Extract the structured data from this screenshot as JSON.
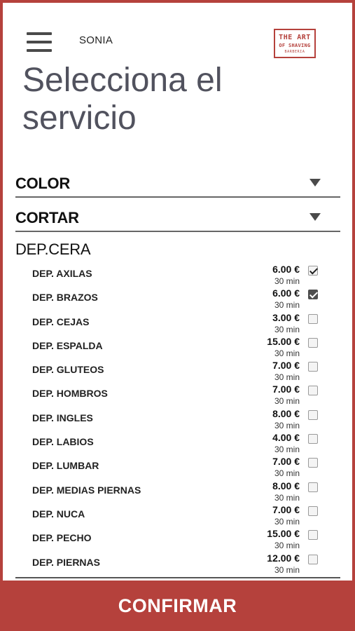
{
  "header": {
    "user_name": "SONIA",
    "logo": {
      "line1": "THE ART",
      "line2": "OF SHAVING",
      "line3": "BARBERIA"
    }
  },
  "page": {
    "title": "Selecciona el servicio"
  },
  "categories": [
    {
      "label": "COLOR",
      "expanded": false
    },
    {
      "label": "CORTAR",
      "expanded": false
    },
    {
      "label": "DEP.CERA",
      "expanded": true
    }
  ],
  "services": [
    {
      "name": "DEP. AXILAS",
      "price": "6.00 €",
      "duration": "30 min",
      "checked": true
    },
    {
      "name": "DEP. BRAZOS",
      "price": "6.00 €",
      "duration": "30 min",
      "checked": true,
      "focused": true
    },
    {
      "name": "DEP. CEJAS",
      "price": "3.00 €",
      "duration": "30 min",
      "checked": false
    },
    {
      "name": "DEP. ESPALDA",
      "price": "15.00 €",
      "duration": "30 min",
      "checked": false
    },
    {
      "name": "DEP. GLUTEOS",
      "price": "7.00 €",
      "duration": "30 min",
      "checked": false
    },
    {
      "name": "DEP. HOMBROS",
      "price": "7.00 €",
      "duration": "30 min",
      "checked": false
    },
    {
      "name": "DEP. INGLES",
      "price": "8.00 €",
      "duration": "30 min",
      "checked": false
    },
    {
      "name": "DEP. LABIOS",
      "price": "4.00 €",
      "duration": "30 min",
      "checked": false
    },
    {
      "name": "DEP. LUMBAR",
      "price": "7.00 €",
      "duration": "30 min",
      "checked": false
    },
    {
      "name": "DEP. MEDIAS PIERNAS",
      "price": "8.00 €",
      "duration": "30 min",
      "checked": false
    },
    {
      "name": "DEP. NUCA",
      "price": "7.00 €",
      "duration": "30 min",
      "checked": false
    },
    {
      "name": "DEP. PECHO",
      "price": "15.00 €",
      "duration": "30 min",
      "checked": false
    },
    {
      "name": "DEP. PIERNAS",
      "price": "12.00 €",
      "duration": "30 min",
      "checked": false
    }
  ],
  "footer": {
    "confirm_label": "CONFIRMAR"
  },
  "colors": {
    "accent": "#b5413c",
    "title": "#51525e"
  },
  "icons": {
    "menu": "hamburger-menu-icon",
    "collapse": "caret-down-icon",
    "logo": "barber-logo-icon"
  }
}
